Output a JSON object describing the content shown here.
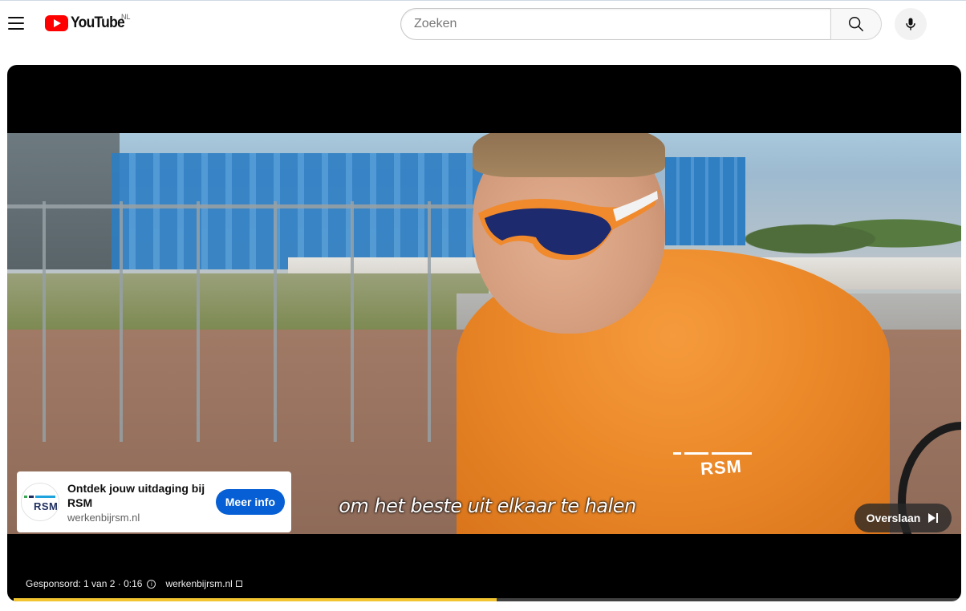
{
  "header": {
    "logo_text": "YouTube",
    "country_code": "NL",
    "search_placeholder": "Zoeken"
  },
  "player": {
    "subtitle": "om het beste uit elkaar te halen",
    "ad_card": {
      "logo_text": "RSM",
      "title": "Ontdek jouw uitdaging bij RSM",
      "domain": "werkenbijrsm.nl",
      "cta_label": "Meer info"
    },
    "skip_label": "Overslaan",
    "sponsor": {
      "label": "Gesponsord: 1 van 2 · 0:16",
      "link": "werkenbijrsm.nl"
    },
    "progress_fraction": 0.51,
    "colors": {
      "progress": "#f2c430",
      "cta": "#065fd4",
      "brand_red": "#ff0000"
    }
  },
  "icons": [
    "menu-icon",
    "youtube-logo-icon",
    "search-icon",
    "microphone-icon",
    "info-icon",
    "external-link-icon",
    "skip-next-icon"
  ]
}
